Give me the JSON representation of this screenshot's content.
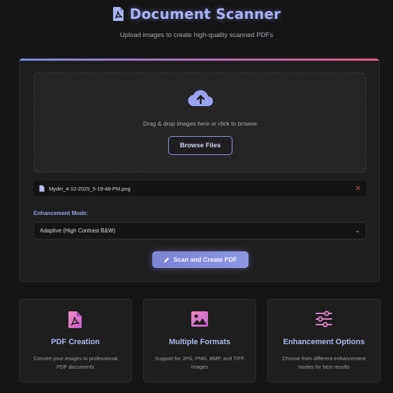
{
  "header": {
    "title": "Document Scanner",
    "subtitle": "Upload images to create high-quality scanned PDFs",
    "title_icon": "pdf-file-icon"
  },
  "upload": {
    "icon": "cloud-upload-icon",
    "drop_text": "Drag & drop images here or click to browse",
    "browse_label": "Browse Files"
  },
  "file": {
    "icon": "image-file-icon",
    "name": "Mydei_4-10-2025_5-19-48-PM.png",
    "remove_glyph": "✕"
  },
  "enhancement": {
    "label": "Enhancement Mode:",
    "selected": "Adaptive (High Contrast B&W)",
    "chevron": "⌄"
  },
  "scan": {
    "label": "Scan and Create PDF",
    "icon": "pencil-icon"
  },
  "features": [
    {
      "icon": "pdf-file-icon",
      "title": "PDF Creation",
      "desc": "Convert your images to professional PDF documents"
    },
    {
      "icon": "image-icon",
      "title": "Multiple Formats",
      "desc": "Support for JPG, PNG, BMP, and TIFF images"
    },
    {
      "icon": "sliders-icon",
      "title": "Enhancement Options",
      "desc": "Choose from different enhancement modes for best results"
    }
  ],
  "colors": {
    "accent": "#aab2f5",
    "gradient_start": "#7d8ae8",
    "gradient_end": "#e8527d",
    "remove": "#e0455a",
    "background": "#151515",
    "card": "#1e1e1e"
  }
}
